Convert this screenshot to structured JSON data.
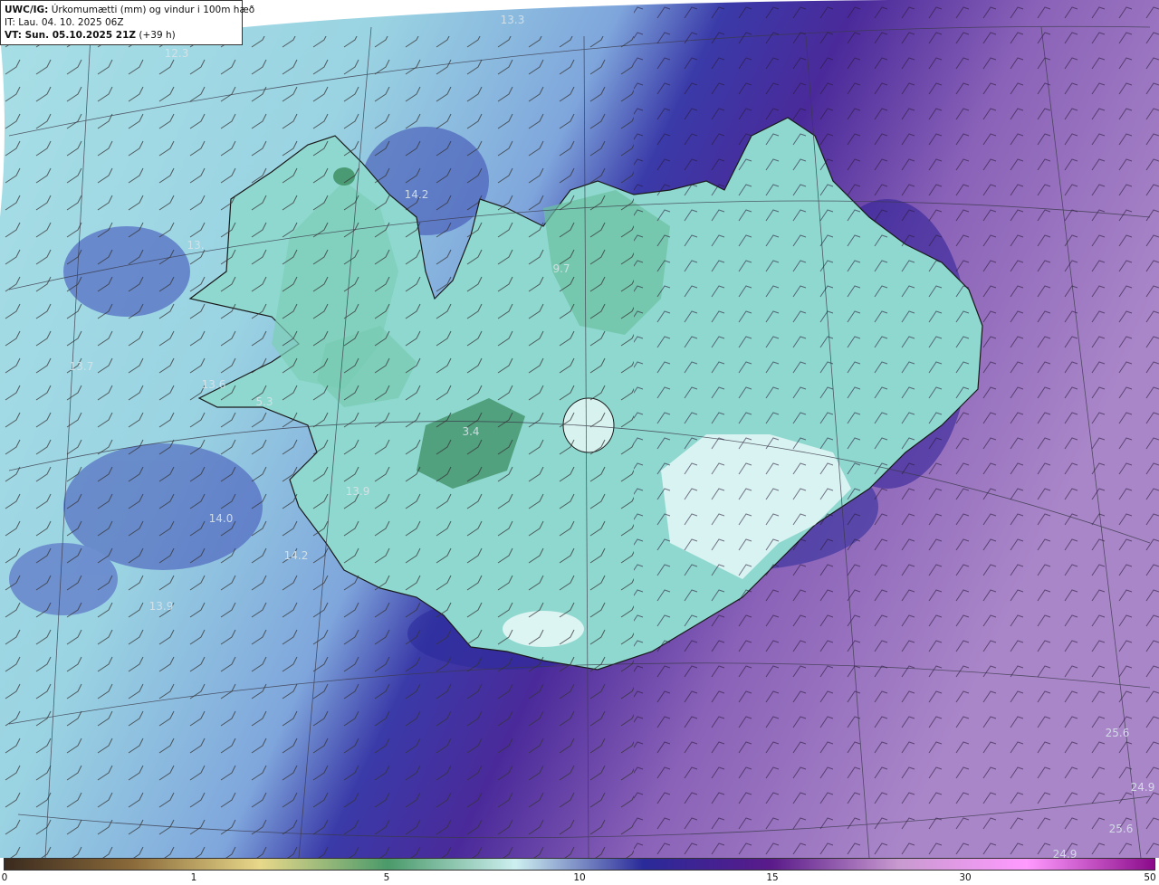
{
  "header": {
    "product": "UWC/IG:",
    "variable": "Úrkomumætti (mm) og vindur i 100m hæð",
    "init_time": "IT: Lau. 04. 10. 2025 06Z",
    "valid_label": "VT: Sun. 05.10.2025 21Z",
    "valid_offset": "(+39 h)"
  },
  "map_labels": [
    "13.3",
    "12.3",
    "14.2",
    "13.",
    "9.7",
    "13.7",
    "13.6",
    "5.3",
    "3.4",
    "13.9",
    "14.0",
    "14.2",
    "13.9",
    "25.6",
    "24.9",
    "25.6",
    "24.9"
  ],
  "colorbar": {
    "ticks": [
      "0",
      "1",
      "5",
      "10",
      "15",
      "30",
      "50"
    ],
    "colors": [
      "#3a2a1e",
      "#8a6a3a",
      "#e8d88a",
      "#4a9a6a",
      "#cdeff0",
      "#2a2a9a",
      "#5a1a8a",
      "#c89ad0",
      "#ff9aff",
      "#8a0a8a"
    ]
  },
  "palette": {
    "ocean_west": "#9fdde6",
    "ocean_east": "#8a62b8",
    "band_blue": "#2a2a9a",
    "land_green": "#6ac8a4",
    "coastline": "#222222"
  }
}
